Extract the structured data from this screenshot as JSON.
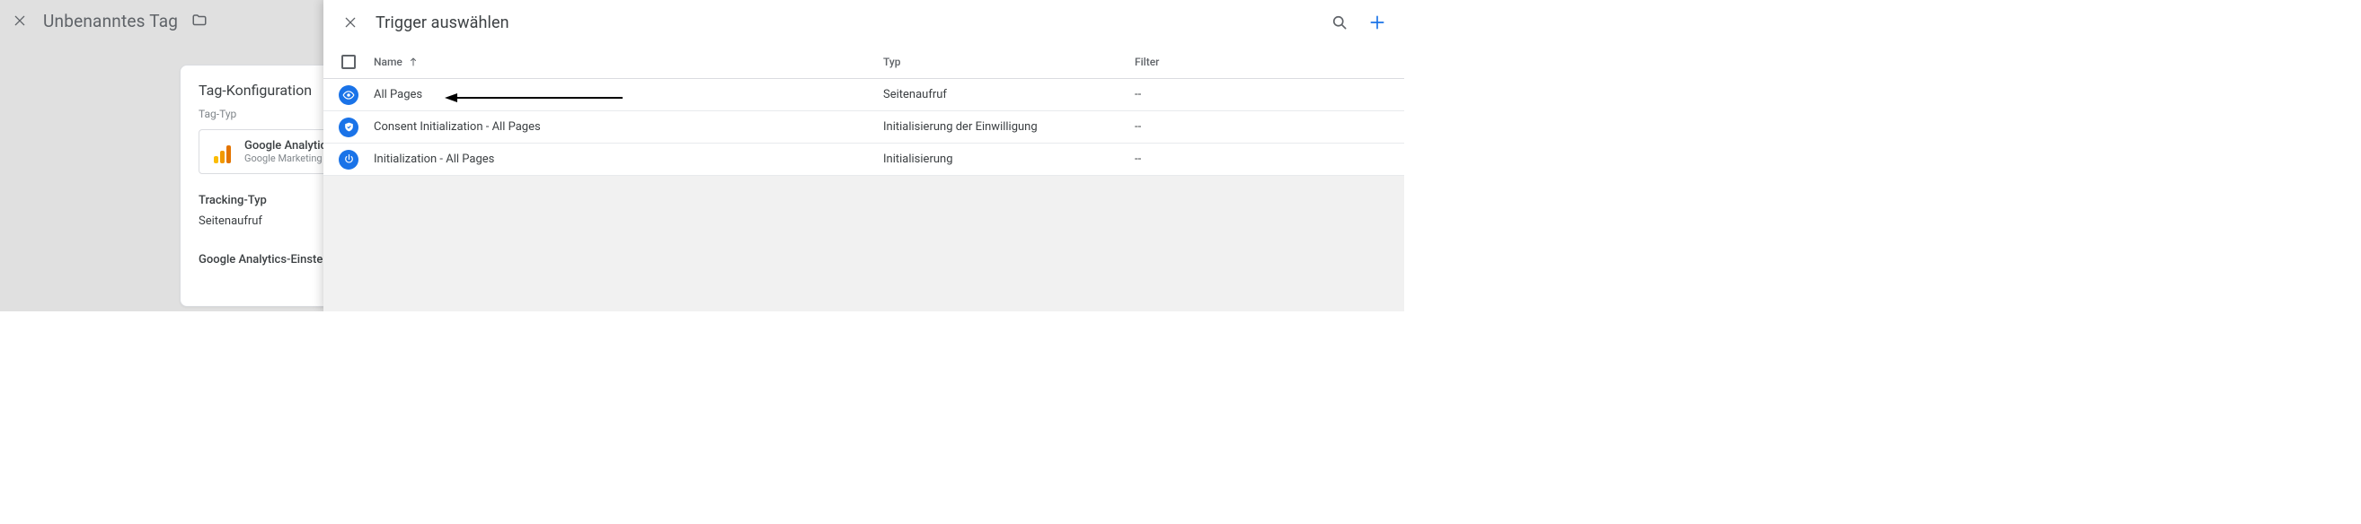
{
  "background": {
    "title": "Unbenanntes Tag",
    "card_title": "Tag-Konfiguration",
    "tagtype_label": "Tag-Typ",
    "tagtype_name": "Google Analytics",
    "tagtype_sub": "Google Marketing",
    "tracking_label": "Tracking-Typ",
    "tracking_value": "Seitenaufruf",
    "ga_settings_label": "Google Analytics-Einstellungen"
  },
  "panel": {
    "title": "Trigger auswählen"
  },
  "columns": {
    "name": "Name",
    "type": "Typ",
    "filter": "Filter"
  },
  "triggers": [
    {
      "icon": "eye",
      "name": "All Pages",
      "type": "Seitenaufruf",
      "filter": "--"
    },
    {
      "icon": "shield",
      "name": "Consent Initialization - All Pages",
      "type": "Initialisierung der Einwilligung",
      "filter": "--"
    },
    {
      "icon": "power",
      "name": "Initialization - All Pages",
      "type": "Initialisierung",
      "filter": "--"
    }
  ]
}
